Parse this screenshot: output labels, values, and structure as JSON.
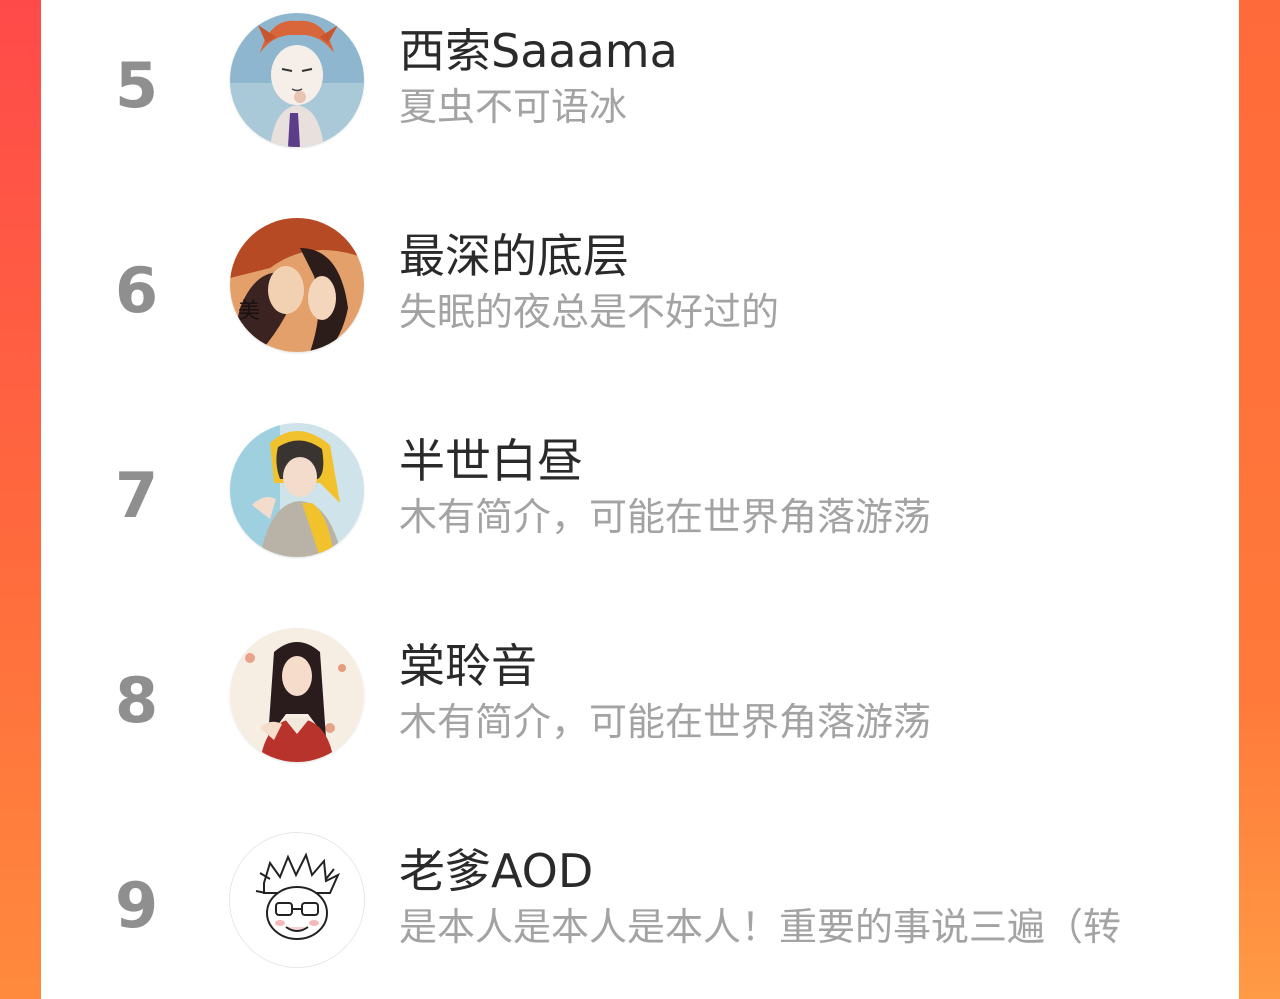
{
  "users": [
    {
      "rank": "5",
      "name": "西索Saaama",
      "bio": "夏虫不可语冰",
      "avatar_icon": "hisoka-avatar-icon"
    },
    {
      "rank": "6",
      "name": "最深的底层",
      "bio": "失眠的夜总是不好过的",
      "avatar_icon": "couple-avatar-icon"
    },
    {
      "rank": "7",
      "name": "半世白昼",
      "bio": "木有简介，可能在世界角落游荡",
      "avatar_icon": "yellow-hood-avatar-icon"
    },
    {
      "rank": "8",
      "name": "棠聆音",
      "bio": "木有简介，可能在世界角落游荡",
      "avatar_icon": "longhair-avatar-icon"
    },
    {
      "rank": "9",
      "name": "老爹AOD",
      "bio": "是本人是本人是本人！重要的事说三遍（转",
      "avatar_icon": "sketch-avatar-icon"
    }
  ],
  "colors": {
    "accent": "#ff5a3d",
    "rank": "#8f8f8f",
    "name": "#2a2a2a",
    "bio": "#a3a3a3"
  }
}
